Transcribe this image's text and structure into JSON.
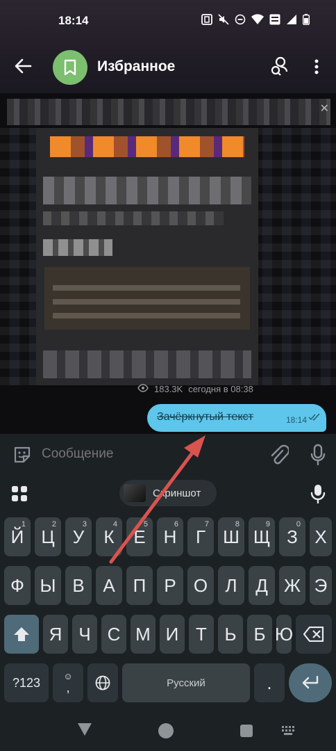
{
  "status_bar": {
    "time": "18:14"
  },
  "header": {
    "title": "Избранное"
  },
  "chat": {
    "post_meta": {
      "views": "183.3K",
      "date": "сегодня в 08:38"
    },
    "message": {
      "text": "Зачёркнутый текст",
      "time": "18:14"
    }
  },
  "composer": {
    "placeholder": "Сообщение"
  },
  "keyboard": {
    "clipboard_chip": "Скриншот",
    "row1": [
      {
        "l": "Й",
        "s": "1"
      },
      {
        "l": "Ц",
        "s": "2"
      },
      {
        "l": "У",
        "s": "3"
      },
      {
        "l": "К",
        "s": "4"
      },
      {
        "l": "Е",
        "s": "5"
      },
      {
        "l": "Н",
        "s": "6"
      },
      {
        "l": "Г",
        "s": "7"
      },
      {
        "l": "Ш",
        "s": "8"
      },
      {
        "l": "Щ",
        "s": "9"
      },
      {
        "l": "З",
        "s": "0"
      },
      {
        "l": "Х",
        "s": ""
      }
    ],
    "row2": [
      "Ф",
      "Ы",
      "В",
      "А",
      "П",
      "Р",
      "О",
      "Л",
      "Д",
      "Ж",
      "Э"
    ],
    "row3": [
      "Я",
      "Ч",
      "С",
      "М",
      "И",
      "Т",
      "Ь",
      "Б",
      "Ю"
    ],
    "symbols_label": "?123",
    "comma_label": ",",
    "space_label": "Русский",
    "period_label": "."
  },
  "colors": {
    "accent": "#5ec6ea",
    "avatar": "#7bbf6f",
    "arrow": "#d9534f"
  }
}
